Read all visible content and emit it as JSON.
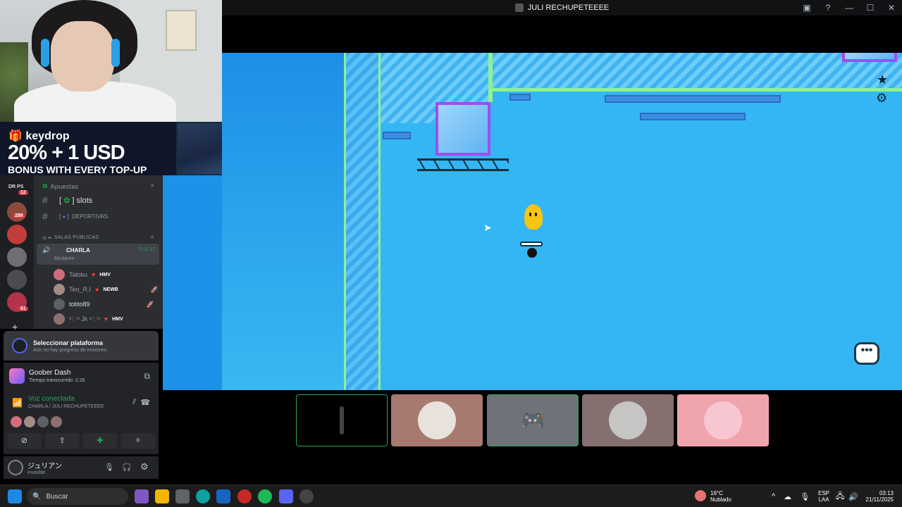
{
  "window": {
    "title": "JULI RECHUPETEEEE"
  },
  "banner": {
    "brand": "keydrop",
    "headline": "20% + 1 USD",
    "subline": "BONUS WITH EVERY TOP-UP"
  },
  "servers": {
    "badges": [
      "12",
      "288",
      "61"
    ],
    "top_label": "DR  PS"
  },
  "channels": {
    "category1": "Apuestas",
    "channel_slots": "slots",
    "channel_deportivas": "DEPORTIVAS",
    "category2": "SALAS PUBLICAS",
    "voice_channel": "CHARLA",
    "voice_timer": "3:11:17",
    "voice_status": "Mcclaren",
    "users": [
      {
        "name": "Taloku",
        "tag": "HMV"
      },
      {
        "name": "Teo_R.I",
        "tag": "NEWB"
      },
      {
        "name": "totito89",
        "tag": ""
      },
      {
        "name": "ᵒ♡ᵒ Jk ᵒ♡ᵒ",
        "tag": "HMV"
      }
    ]
  },
  "activity": {
    "title": "Seleccionar plataforma",
    "subtitle": "Aún no hay progreso de misiones"
  },
  "game": {
    "name": "Goober Dash",
    "time": "Tiempo transcurrido: 2:26"
  },
  "voice": {
    "status": "Voz conectada",
    "location": "CHARLA / JULI RECHUPETEEEE"
  },
  "user": {
    "name": "ジュリアン",
    "status": "Invisible"
  },
  "taskbar": {
    "search_placeholder": "Buscar",
    "weather_temp": "16°C",
    "weather_desc": "Nublado",
    "lang1": "ESP",
    "lang2": "LAA",
    "time": "03:13",
    "date": "21/11/2025"
  }
}
